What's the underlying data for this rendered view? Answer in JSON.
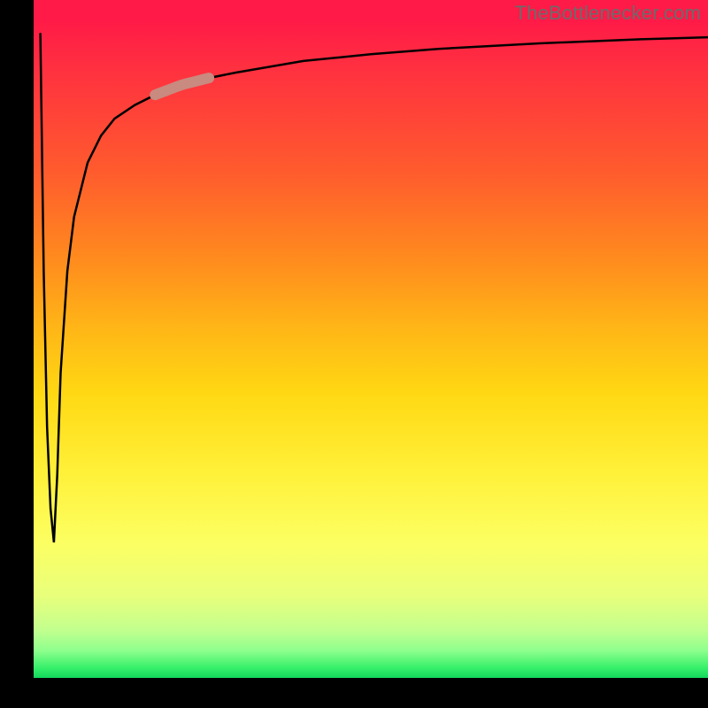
{
  "watermark": {
    "text": "TheBottlenecker.com"
  },
  "chart_data": {
    "type": "line",
    "title": "",
    "xlabel": "",
    "ylabel": "",
    "xlim": [
      0,
      100
    ],
    "ylim": [
      0,
      100
    ],
    "axes_visible": false,
    "background_gradient": {
      "orientation": "vertical",
      "stops": [
        {
          "pos": 0.0,
          "color": "#ff1a47"
        },
        {
          "pos": 0.25,
          "color": "#ff5a2e"
        },
        {
          "pos": 0.5,
          "color": "#ffc016"
        },
        {
          "pos": 0.75,
          "color": "#fcff4e"
        },
        {
          "pos": 0.95,
          "color": "#9dff8a"
        },
        {
          "pos": 1.0,
          "color": "#12d85d"
        }
      ]
    },
    "series": [
      {
        "name": "bottleneck-curve",
        "color": "#000000",
        "stroke_width": 2.5,
        "x": [
          1.0,
          1.5,
          2.0,
          2.5,
          3.0,
          3.5,
          4.0,
          5.0,
          6.0,
          8.0,
          10,
          12,
          15,
          18,
          22,
          26,
          30,
          40,
          50,
          60,
          75,
          90,
          100
        ],
        "y_top": [
          95,
          60,
          37,
          25,
          20,
          30,
          45,
          60,
          68,
          76,
          80,
          82.5,
          84.5,
          86,
          87.5,
          88.5,
          89.3,
          91,
          92,
          92.8,
          93.6,
          94.2,
          94.5
        ],
        "note": "y_top is percent height from bottom; curve dips near x≈3 then rises asymptotically"
      }
    ],
    "highlight_segment": {
      "series": "bottleneck-curve",
      "x_start": 18,
      "x_end": 26,
      "color": "#c98a80",
      "stroke_width": 12,
      "linecap": "round"
    }
  }
}
